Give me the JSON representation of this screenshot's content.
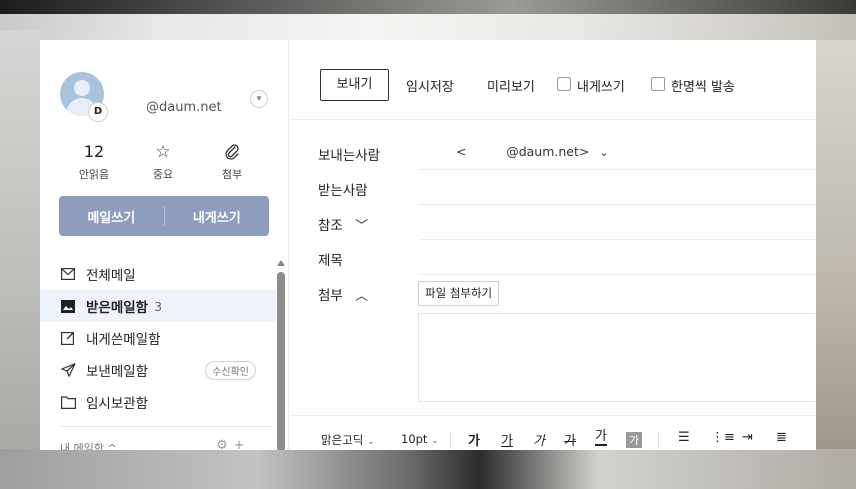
{
  "account": {
    "avatar_letter": "D",
    "email": "@daum.net"
  },
  "stats": {
    "unread_count": "12",
    "unread_label": "안읽음",
    "important_label": "중요",
    "attach_label": "첨부"
  },
  "compose": {
    "write_label": "메일쓰기",
    "self_write_label": "내게쓰기"
  },
  "folders": [
    {
      "label": "전체메일",
      "icon": "envelope-icon"
    },
    {
      "label": "받은메일함",
      "count": "3",
      "icon": "inbox-icon"
    },
    {
      "label": "내게쓴메일함",
      "icon": "note-icon"
    },
    {
      "label": "보낸메일함",
      "badge": "수신확인",
      "icon": "send-icon"
    },
    {
      "label": "임시보관함",
      "icon": "folder-icon"
    }
  ],
  "my_mailbox": {
    "label": "내 메일함 ^"
  },
  "toolbar": {
    "send_label": "보내기",
    "draft_label": "임시저장",
    "preview_label": "미리보기",
    "self_label": "내게쓰기",
    "individual_label": "한명씩 발송"
  },
  "fields": {
    "sender_label": "보내는사람",
    "sender_value": "<          @daum.net>",
    "to_label": "받는사람",
    "cc_label": "참조",
    "subject_label": "제목",
    "attach_label": "첨부",
    "attach_button": "파일 첨부하기"
  },
  "editor": {
    "font": "맑은고딕",
    "size": "10pt",
    "bold": "가",
    "underline": "가",
    "italic": "가",
    "strike": "가",
    "color": "가",
    "bg_color": "가"
  }
}
